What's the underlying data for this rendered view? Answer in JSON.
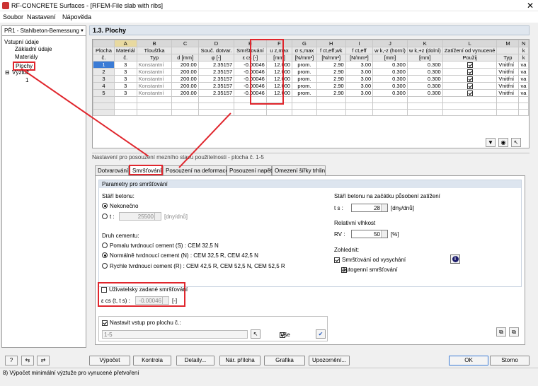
{
  "window": {
    "title": "RF-CONCRETE Surfaces - [RFEM-File slab with ribs]"
  },
  "menu": [
    "Soubor",
    "Nastavení",
    "Nápověda"
  ],
  "left_panel": {
    "combo": "PŘ1 - Stahlbeton-Bemessung",
    "tree": [
      "Vstupní údaje",
      "Základní údaje",
      "Materiály",
      "Plochy",
      "Výztuž",
      "1"
    ]
  },
  "section_header": "1.3. Plochy",
  "table": {
    "letters": [
      "A",
      "B",
      "C",
      "D",
      "E",
      "F",
      "G",
      "H",
      "I",
      "J",
      "K",
      "L",
      "M",
      "N"
    ],
    "header1": [
      "Plocha",
      "Materiál",
      "Tloušťka",
      "",
      "Souč. dotvar.",
      "Smršťování",
      "u z,max",
      "σ s,max",
      "f ct,eff,wk",
      "f ct,eff",
      "w k,-z (horní)",
      "w k,+z (dolní)",
      "Zatížení od vynucené",
      "",
      "k"
    ],
    "header2": [
      "č.",
      "č.",
      "Typ",
      "d [mm]",
      "φ [-]",
      "ε cs [-]",
      "[mm]",
      "[N/mm²]",
      "[N/mm²]",
      "[N/mm²]",
      "[mm]",
      "[mm]",
      "Použij",
      "Typ",
      "k"
    ],
    "rows": [
      [
        "1",
        "3",
        "Konstantní",
        "200.00",
        "2.35157",
        "-0.00046",
        "12.000",
        "prom.",
        "2.90",
        "3.00",
        "0.300",
        "0.300",
        "☑",
        "Vnitřní",
        "va"
      ],
      [
        "2",
        "3",
        "Konstantní",
        "200.00",
        "2.35157",
        "-0.00046",
        "12.000",
        "prom.",
        "2.90",
        "3.00",
        "0.300",
        "0.300",
        "☑",
        "Vnitřní",
        "va"
      ],
      [
        "3",
        "3",
        "Konstantní",
        "200.00",
        "2.35157",
        "-0.00046",
        "12.000",
        "prom.",
        "2.90",
        "3.00",
        "0.300",
        "0.300",
        "☑",
        "Vnitřní",
        "va"
      ],
      [
        "4",
        "3",
        "Konstantní",
        "200.00",
        "2.35157",
        "-0.00046",
        "12.000",
        "prom.",
        "2.90",
        "3.00",
        "0.300",
        "0.300",
        "☑",
        "Vnitřní",
        "va"
      ],
      [
        "5",
        "3",
        "Konstantní",
        "200.00",
        "2.35157",
        "-0.00046",
        "12.000",
        "prom.",
        "2.90",
        "3.00",
        "0.300",
        "0.300",
        "☑",
        "Vnitřní",
        "va"
      ]
    ]
  },
  "settings_label": "Nastavení pro posouzení mezního stavu použitelnosti - plocha č. 1-5",
  "tabs": [
    "Dotvarování",
    "Smršťování",
    "Posouzení na deformace",
    "Posouzení napětí",
    "Omezení šířky trhlin"
  ],
  "shrinkage": {
    "group_title": "Parametry pro smršťování",
    "age_title": "Stáří betonu:",
    "age_infinite": "Nekonečno",
    "age_t": "t :",
    "age_t_value": "25500",
    "age_t_unit": "[dny/dnů]",
    "cement_title": "Druh cementu:",
    "cement_slow": "Pomalu tvrdnoucí cement (S) : CEM 32,5 N",
    "cement_normal": "Normálně tvrdnoucí cement (N) : CEM 32,5 R, CEM 42,5 N",
    "cement_rapid": "Rychle tvrdnoucí cement (R) : CEM 42,5 R, CEM 52,5 N, CEM 52,5 R",
    "ts_title": "Stáří betonu na začátku působení zatížení",
    "ts_label": "t s :",
    "ts_value": "28",
    "ts_unit": "[dny/dnů]",
    "rh_title": "Relativní vlhkost",
    "rh_label": "RV :",
    "rh_value": "50",
    "rh_unit": "[%]",
    "consider_title": "Zohlednit:",
    "drying": "Smršťování od vysychání",
    "autogenous": "Autogenní smršťování",
    "user_defined": "Uživatelsky zadané smršťování",
    "ecs_label": "ε cs (t, t s) :",
    "ecs_value": "-0.00046",
    "ecs_unit": "[-]"
  },
  "apply": {
    "label": "Nastavit vstup pro plochu č.:",
    "value": "1-5",
    "all": "Vše"
  },
  "buttons": [
    "Výpočet",
    "Kontrola",
    "Detaily...",
    "Nár. příloha",
    "Grafika",
    "Upozornění...",
    "OK",
    "Storno"
  ],
  "status": "8) Výpočet minimální výztuže pro vynucené přetvoření"
}
